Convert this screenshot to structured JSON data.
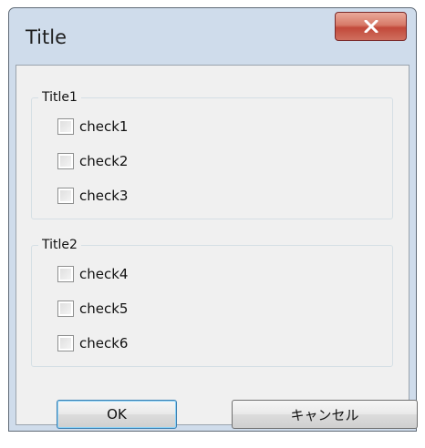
{
  "window": {
    "title": "Title"
  },
  "groups": [
    {
      "title": "Title1",
      "checks": [
        {
          "label": "check1",
          "checked": false
        },
        {
          "label": "check2",
          "checked": false
        },
        {
          "label": "check3",
          "checked": false
        }
      ]
    },
    {
      "title": "Title2",
      "checks": [
        {
          "label": "check4",
          "checked": false
        },
        {
          "label": "check5",
          "checked": false
        },
        {
          "label": "check6",
          "checked": false
        }
      ]
    }
  ],
  "buttons": {
    "ok_label": "OK",
    "cancel_label": "キャンセル"
  },
  "icons": {
    "close": "close-icon",
    "checkbox": "checkbox-icon"
  },
  "colors": {
    "close_button": "#c2493a",
    "client_background": "#f0f0f0",
    "frame": "#cfdceb",
    "default_button_border": "#3c7fb1"
  }
}
